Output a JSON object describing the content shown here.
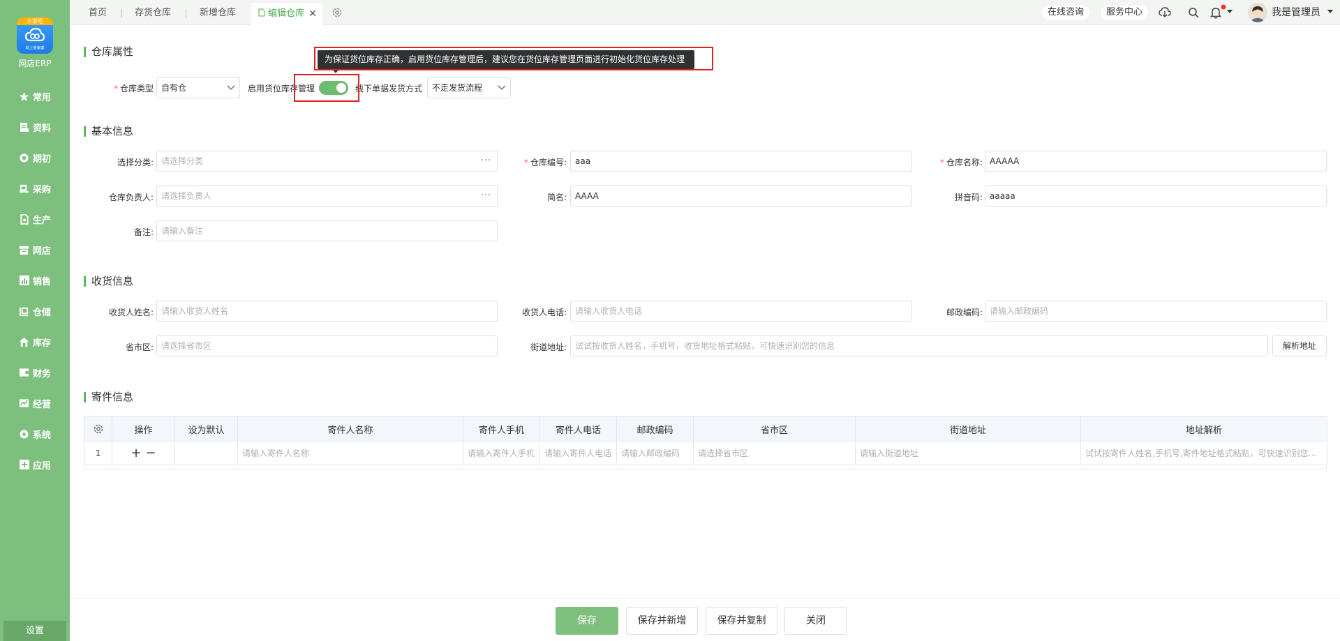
{
  "sidebar": {
    "logo_top": "大掌柜",
    "logo_sub": "网上管家婆",
    "brand": "网店ERP",
    "items": [
      {
        "label": "常用",
        "icon": "star-icon"
      },
      {
        "label": "资料",
        "icon": "document-icon"
      },
      {
        "label": "期初",
        "icon": "cycle-icon"
      },
      {
        "label": "采购",
        "icon": "purchase-icon"
      },
      {
        "label": "生产",
        "icon": "production-icon"
      },
      {
        "label": "网店",
        "icon": "store-icon"
      },
      {
        "label": "销售",
        "icon": "chart-icon"
      },
      {
        "label": "仓储",
        "icon": "warehouse-icon"
      },
      {
        "label": "库存",
        "icon": "home-icon"
      },
      {
        "label": "财务",
        "icon": "wallet-icon"
      },
      {
        "label": "经营",
        "icon": "trend-icon"
      },
      {
        "label": "系统",
        "icon": "gear-icon"
      },
      {
        "label": "应用",
        "icon": "plus-icon"
      }
    ],
    "settings_label": "设置"
  },
  "topbar": {
    "tabs": [
      "首页",
      "存货仓库",
      "新增仓库"
    ],
    "active_tab": "编辑仓库",
    "online_consult": "在线咨询",
    "service_center": "服务中心",
    "user_name": "我是管理员"
  },
  "warehouse_props": {
    "title": "仓库属性",
    "type_label": "仓库类型",
    "type_value": "自有仓",
    "bin_label": "启用货位库存管理",
    "bin_enabled": true,
    "offline_label": "线下单据发货方式",
    "offline_value": "不走发货流程",
    "tooltip": "为保证货位库存正确，启用货位库存管理后，建议您在货位库存管理页面进行初始化货位库存处理"
  },
  "basic_info": {
    "title": "基本信息",
    "category_label": "选择分类:",
    "category_placeholder": "请选择分类",
    "code_label": "仓库编号:",
    "code_value": "aaa",
    "name_label": "仓库名称:",
    "name_value": "AAAAA",
    "manager_label": "仓库负责人:",
    "manager_placeholder": "请选择负责人",
    "short_label": "简名:",
    "short_value": "AAAA",
    "pinyin_label": "拼音码:",
    "pinyin_value": "aaaaa",
    "remark_label": "备注:",
    "remark_placeholder": "请输入备注"
  },
  "receive_info": {
    "title": "收货信息",
    "name_label": "收货人姓名:",
    "name_placeholder": "请输入收货人姓名",
    "phone_label": "收货人电话:",
    "phone_placeholder": "请输入收货人电话",
    "zip_label": "邮政编码:",
    "zip_placeholder": "请输入邮政编码",
    "region_label": "省市区:",
    "region_placeholder": "请选择省市区",
    "street_label": "街道地址:",
    "street_placeholder": "试试按收货人姓名，手机号，收货地址格式粘贴，可快速识别您的信息",
    "parse_button": "解析地址"
  },
  "sender_info": {
    "title": "寄件信息",
    "columns": [
      "操作",
      "设为默认",
      "寄件人名称",
      "寄件人手机",
      "寄件人电话",
      "邮政编码",
      "省市区",
      "街道地址",
      "地址解析"
    ],
    "row": {
      "index": "1",
      "ops": "+ −",
      "name": "请输入寄件人名称",
      "mobile": "请输入寄件人手机",
      "phone": "请输入寄件人电话",
      "zip": "请输入邮政编码",
      "region": "请选择省市区",
      "street": "请输入街道地址",
      "parse": "试试按寄件人姓名,手机号,寄件地址格式粘贴，可快速识别您..."
    }
  },
  "footer": {
    "save": "保存",
    "save_new": "保存并新增",
    "save_copy": "保存并复制",
    "close": "关闭"
  }
}
